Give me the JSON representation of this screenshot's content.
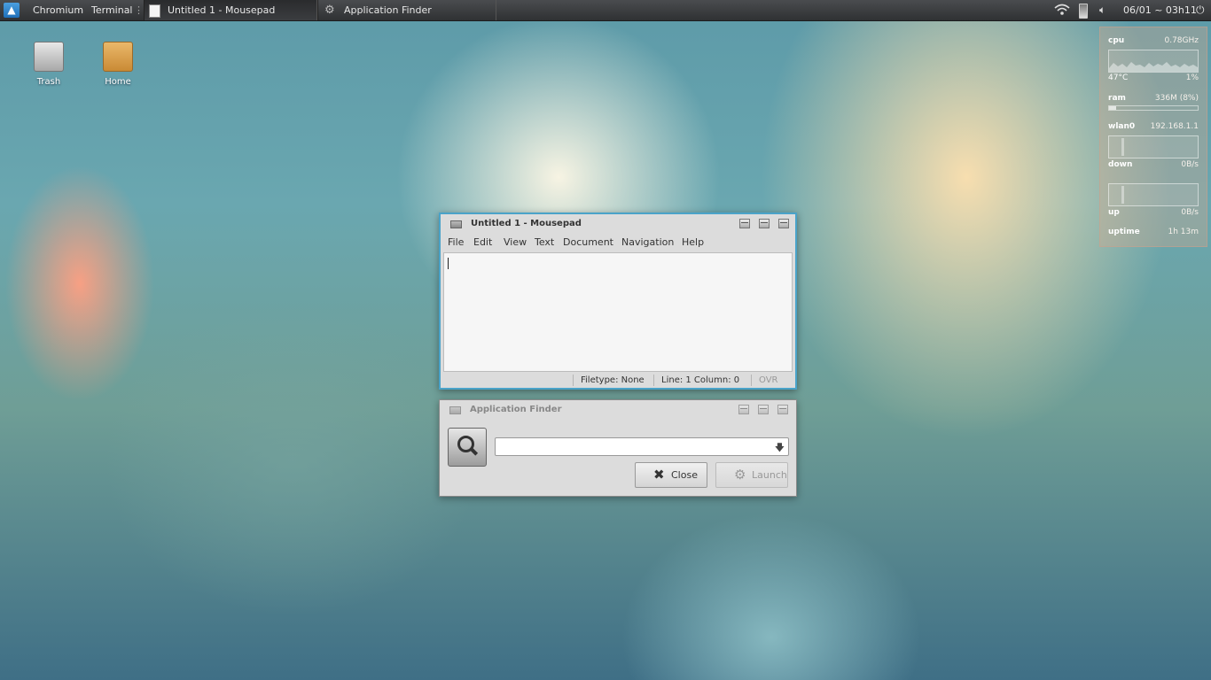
{
  "panel": {
    "launchers": [
      "Chromium",
      "Terminal"
    ],
    "tasks": [
      {
        "label": "Untitled 1 - Mousepad",
        "icon": "text-editor-icon",
        "active": true
      },
      {
        "label": "Application Finder",
        "icon": "gears-icon",
        "active": false
      }
    ],
    "clock": "06/01 ~ 03h11",
    "tray_icons": [
      "wifi-icon",
      "battery-icon",
      "volume-icon",
      "power-icon"
    ]
  },
  "desktop": {
    "icons": [
      {
        "label": "Trash"
      },
      {
        "label": "Home"
      }
    ]
  },
  "conky": {
    "cpu_label": "cpu",
    "cpu_freq": "0.78GHz",
    "cpu_temp": "47°C",
    "cpu_usage": "1%",
    "ram_label": "ram",
    "ram_value": "336M (8%)",
    "ram_fraction": 0.08,
    "net_label": "wlan0",
    "net_ip": "192.168.1.1",
    "down_label": "down",
    "down_value": "0B/s",
    "up_label": "up",
    "up_value": "0B/s",
    "uptime_label": "uptime",
    "uptime_value": "1h 13m"
  },
  "mousepad": {
    "title": "Untitled 1 - Mousepad",
    "menu": [
      "File",
      "Edit",
      "View",
      "Text",
      "Document",
      "Navigation",
      "Help"
    ],
    "status": {
      "filetype": "Filetype: None",
      "position": "Line: 1 Column: 0",
      "mode": "OVR"
    }
  },
  "finder": {
    "title": "Application Finder",
    "search_value": "",
    "close_label": "Close",
    "launch_label": "Launch"
  },
  "colors": {
    "panel": "#3a3c3f",
    "active_window_border": "#4aa3c9",
    "window_bg": "#dcdcdc"
  }
}
